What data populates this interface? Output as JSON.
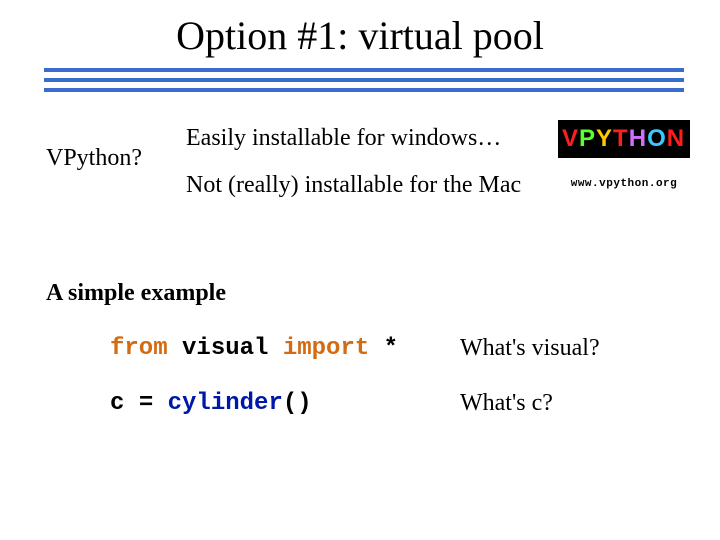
{
  "title": "Option #1:  virtual pool",
  "vpython_label": "VPython?",
  "info_line1": "Easily installable for windows…",
  "info_line2": "Not (really) installable for the Mac",
  "logo": {
    "letters": [
      "V",
      "P",
      "Y",
      "T",
      "H",
      "O",
      "N"
    ],
    "url": "www.vpython.org"
  },
  "example_heading": "A simple example",
  "code": {
    "from": "from",
    "module": "visual",
    "import": "import",
    "star": "*",
    "var": "c",
    "eq": "=",
    "func": "cylinder",
    "parens": "()"
  },
  "question1": "What's visual?",
  "question2": "What's c?"
}
